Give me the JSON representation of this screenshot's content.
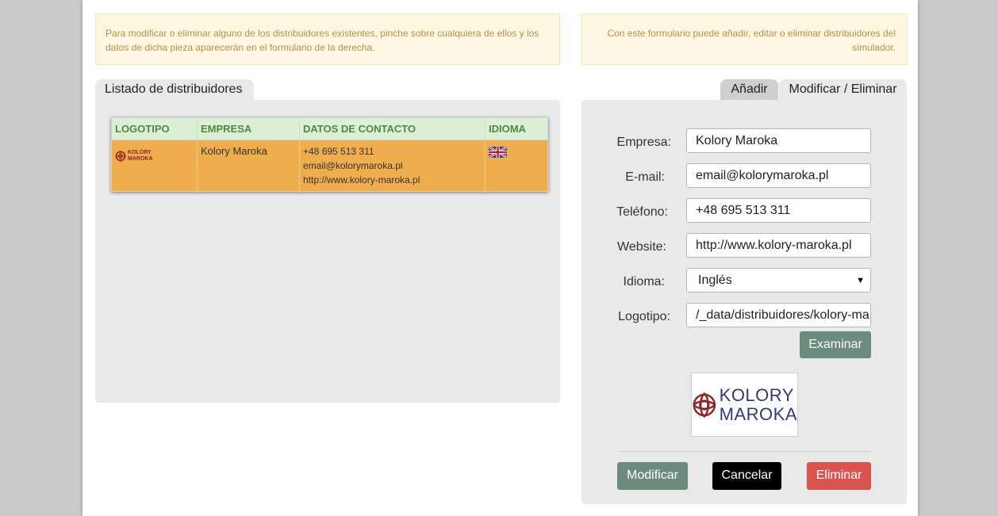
{
  "notices": {
    "left": "Para modificar o eliminar alguno de los distribuidores existentes, pinche sobre cualquiera de ellos y los datos de dicha pieza aparecerán en el formulario de la derecha.",
    "right": "Con este formulario puede añadir, editar o eliminar distribuidores del simulador."
  },
  "tabs": {
    "list": "Listado de distribuidores",
    "add": "Añadir",
    "modify": "Modificar / Eliminar"
  },
  "table": {
    "headers": [
      "LOGOTIPO",
      "EMPRESA",
      "DATOS DE CONTACTO",
      "IDIOMA"
    ],
    "rows": [
      {
        "logo_text_line1": "KOLORY",
        "logo_text_line2": "MAROKA",
        "empresa": "Kolory Maroka",
        "telefono": "+48 695 513 311",
        "email": "email@kolorymaroka.pl",
        "web": "http://www.kolory-maroka.pl",
        "idioma_icon": "uk-flag-icon"
      }
    ]
  },
  "form": {
    "empresa_label": "Empresa:",
    "empresa_value": "Kolory Maroka",
    "email_label": "E-mail:",
    "email_value": "email@kolorymaroka.pl",
    "telefono_label": "Teléfono:",
    "telefono_value": "+48 695 513 311",
    "website_label": "Website:",
    "website_value": "http://www.kolory-maroka.pl",
    "idioma_label": "Idioma:",
    "idioma_value": "Inglés",
    "logotipo_label": "Logotipo:",
    "logotipo_value": "/_data/distribuidores/kolory-ma",
    "examinar": "Examinar",
    "logo_line1": "KOLORY",
    "logo_line2": "MAROKA"
  },
  "actions": {
    "modificar": "Modificar",
    "cancelar": "Cancelar",
    "eliminar": "Eliminar"
  },
  "colors": {
    "row_highlight": "#f0ad4e",
    "header_bg": "#ddefd6",
    "primary_button": "#6b8b7f",
    "danger_button": "#d9534f",
    "logo_red": "#8e2326",
    "logo_blue": "#343a78"
  }
}
